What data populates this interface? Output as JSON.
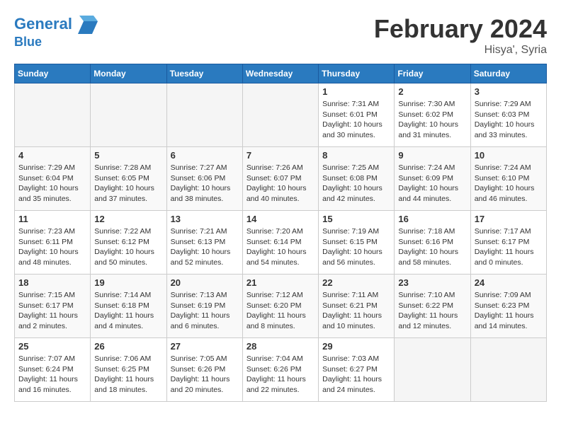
{
  "logo": {
    "line1": "General",
    "line2": "Blue"
  },
  "title": "February 2024",
  "location": "Hisya', Syria",
  "days_header": [
    "Sunday",
    "Monday",
    "Tuesday",
    "Wednesday",
    "Thursday",
    "Friday",
    "Saturday"
  ],
  "weeks": [
    [
      {
        "day": "",
        "info": ""
      },
      {
        "day": "",
        "info": ""
      },
      {
        "day": "",
        "info": ""
      },
      {
        "day": "",
        "info": ""
      },
      {
        "day": "1",
        "info": "Sunrise: 7:31 AM\nSunset: 6:01 PM\nDaylight: 10 hours\nand 30 minutes."
      },
      {
        "day": "2",
        "info": "Sunrise: 7:30 AM\nSunset: 6:02 PM\nDaylight: 10 hours\nand 31 minutes."
      },
      {
        "day": "3",
        "info": "Sunrise: 7:29 AM\nSunset: 6:03 PM\nDaylight: 10 hours\nand 33 minutes."
      }
    ],
    [
      {
        "day": "4",
        "info": "Sunrise: 7:29 AM\nSunset: 6:04 PM\nDaylight: 10 hours\nand 35 minutes."
      },
      {
        "day": "5",
        "info": "Sunrise: 7:28 AM\nSunset: 6:05 PM\nDaylight: 10 hours\nand 37 minutes."
      },
      {
        "day": "6",
        "info": "Sunrise: 7:27 AM\nSunset: 6:06 PM\nDaylight: 10 hours\nand 38 minutes."
      },
      {
        "day": "7",
        "info": "Sunrise: 7:26 AM\nSunset: 6:07 PM\nDaylight: 10 hours\nand 40 minutes."
      },
      {
        "day": "8",
        "info": "Sunrise: 7:25 AM\nSunset: 6:08 PM\nDaylight: 10 hours\nand 42 minutes."
      },
      {
        "day": "9",
        "info": "Sunrise: 7:24 AM\nSunset: 6:09 PM\nDaylight: 10 hours\nand 44 minutes."
      },
      {
        "day": "10",
        "info": "Sunrise: 7:24 AM\nSunset: 6:10 PM\nDaylight: 10 hours\nand 46 minutes."
      }
    ],
    [
      {
        "day": "11",
        "info": "Sunrise: 7:23 AM\nSunset: 6:11 PM\nDaylight: 10 hours\nand 48 minutes."
      },
      {
        "day": "12",
        "info": "Sunrise: 7:22 AM\nSunset: 6:12 PM\nDaylight: 10 hours\nand 50 minutes."
      },
      {
        "day": "13",
        "info": "Sunrise: 7:21 AM\nSunset: 6:13 PM\nDaylight: 10 hours\nand 52 minutes."
      },
      {
        "day": "14",
        "info": "Sunrise: 7:20 AM\nSunset: 6:14 PM\nDaylight: 10 hours\nand 54 minutes."
      },
      {
        "day": "15",
        "info": "Sunrise: 7:19 AM\nSunset: 6:15 PM\nDaylight: 10 hours\nand 56 minutes."
      },
      {
        "day": "16",
        "info": "Sunrise: 7:18 AM\nSunset: 6:16 PM\nDaylight: 10 hours\nand 58 minutes."
      },
      {
        "day": "17",
        "info": "Sunrise: 7:17 AM\nSunset: 6:17 PM\nDaylight: 11 hours\nand 0 minutes."
      }
    ],
    [
      {
        "day": "18",
        "info": "Sunrise: 7:15 AM\nSunset: 6:17 PM\nDaylight: 11 hours\nand 2 minutes."
      },
      {
        "day": "19",
        "info": "Sunrise: 7:14 AM\nSunset: 6:18 PM\nDaylight: 11 hours\nand 4 minutes."
      },
      {
        "day": "20",
        "info": "Sunrise: 7:13 AM\nSunset: 6:19 PM\nDaylight: 11 hours\nand 6 minutes."
      },
      {
        "day": "21",
        "info": "Sunrise: 7:12 AM\nSunset: 6:20 PM\nDaylight: 11 hours\nand 8 minutes."
      },
      {
        "day": "22",
        "info": "Sunrise: 7:11 AM\nSunset: 6:21 PM\nDaylight: 11 hours\nand 10 minutes."
      },
      {
        "day": "23",
        "info": "Sunrise: 7:10 AM\nSunset: 6:22 PM\nDaylight: 11 hours\nand 12 minutes."
      },
      {
        "day": "24",
        "info": "Sunrise: 7:09 AM\nSunset: 6:23 PM\nDaylight: 11 hours\nand 14 minutes."
      }
    ],
    [
      {
        "day": "25",
        "info": "Sunrise: 7:07 AM\nSunset: 6:24 PM\nDaylight: 11 hours\nand 16 minutes."
      },
      {
        "day": "26",
        "info": "Sunrise: 7:06 AM\nSunset: 6:25 PM\nDaylight: 11 hours\nand 18 minutes."
      },
      {
        "day": "27",
        "info": "Sunrise: 7:05 AM\nSunset: 6:26 PM\nDaylight: 11 hours\nand 20 minutes."
      },
      {
        "day": "28",
        "info": "Sunrise: 7:04 AM\nSunset: 6:26 PM\nDaylight: 11 hours\nand 22 minutes."
      },
      {
        "day": "29",
        "info": "Sunrise: 7:03 AM\nSunset: 6:27 PM\nDaylight: 11 hours\nand 24 minutes."
      },
      {
        "day": "",
        "info": ""
      },
      {
        "day": "",
        "info": ""
      }
    ]
  ]
}
